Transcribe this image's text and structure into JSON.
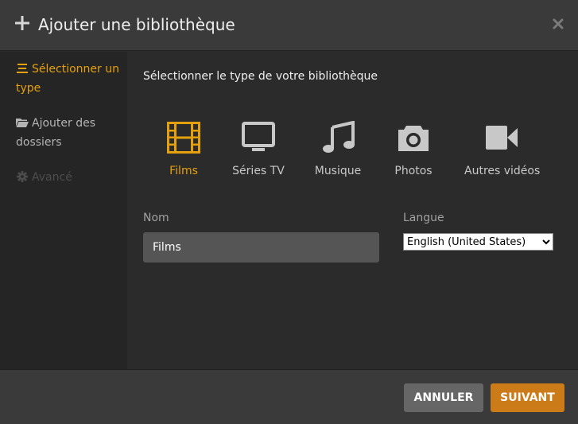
{
  "header": {
    "title": "Ajouter une bibliothèque",
    "plus_icon": "plus-icon",
    "close_icon": "close-icon"
  },
  "sidebar": {
    "items": [
      {
        "label": "Sélectionner un type",
        "icon": "list-icon",
        "state": "active"
      },
      {
        "label": "Ajouter des dossiers",
        "icon": "folder-open-icon",
        "state": "normal"
      },
      {
        "label": "Avancé",
        "icon": "gear-icon",
        "state": "disabled"
      }
    ]
  },
  "main": {
    "heading": "Sélectionner le type de votre bibliothèque",
    "types": [
      {
        "label": "Films",
        "icon": "film-icon",
        "selected": true
      },
      {
        "label": "Séries TV",
        "icon": "tv-icon",
        "selected": false
      },
      {
        "label": "Musique",
        "icon": "music-note-icon",
        "selected": false
      },
      {
        "label": "Photos",
        "icon": "camera-icon",
        "selected": false
      },
      {
        "label": "Autres vidéos",
        "icon": "video-camera-icon",
        "selected": false
      }
    ],
    "name_label": "Nom",
    "name_value": "Films",
    "language_label": "Langue",
    "language_value": "English (United States)"
  },
  "footer": {
    "cancel_label": "ANNULER",
    "next_label": "SUIVANT"
  },
  "colors": {
    "accent": "#e5a00d",
    "next_button": "#cc7b19",
    "cancel_button": "#666666"
  }
}
